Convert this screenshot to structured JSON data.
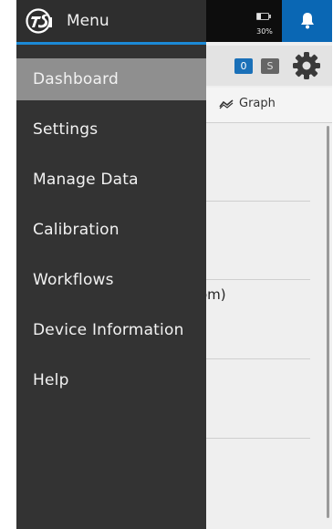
{
  "status_bar": {
    "battery_percent": "30%",
    "battery_level": 0.3
  },
  "drawer": {
    "title": "Menu",
    "items": [
      {
        "label": "Dashboard",
        "active": true
      },
      {
        "label": "Settings"
      },
      {
        "label": "Manage Data"
      },
      {
        "label": "Calibration"
      },
      {
        "label": "Workflows"
      },
      {
        "label": "Device Information"
      },
      {
        "label": "Help"
      }
    ]
  },
  "background": {
    "badges": [
      "0",
      "S"
    ],
    "graph_tab_label": "Graph",
    "partial_text": "om)"
  },
  "colors": {
    "accent_blue": "#0a67b4",
    "drawer_bg": "#333333",
    "active_item_bg": "#8f8f8f",
    "header_underline": "#1c8ad6"
  },
  "icons": [
    "tsi-logo",
    "battery-icon",
    "bell-icon",
    "gear-icon",
    "graph-icon"
  ]
}
